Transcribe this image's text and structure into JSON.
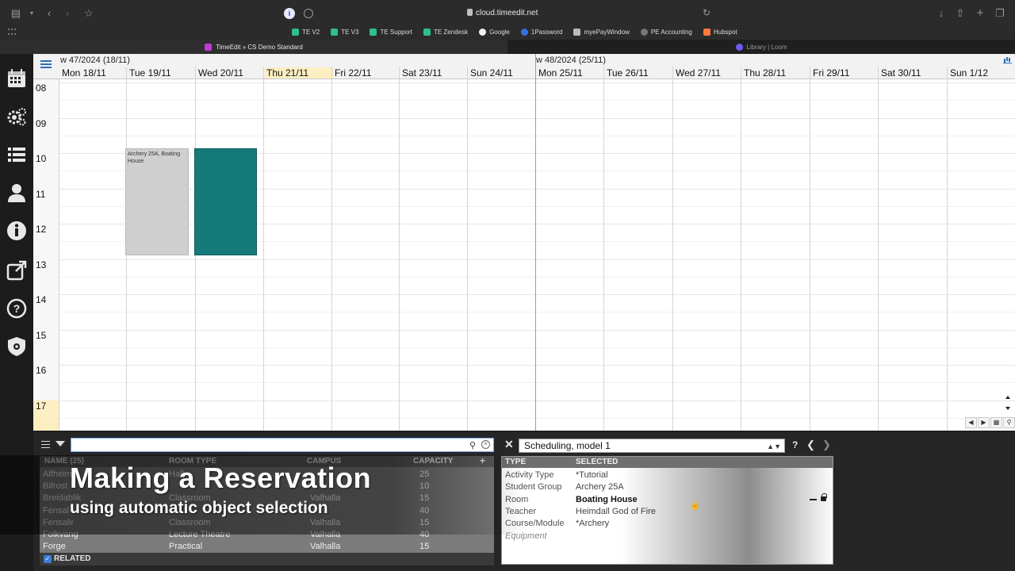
{
  "browser": {
    "url": "cloud.timeedit.net",
    "bookmarks": [
      "TE V2",
      "TE V3",
      "TE Support",
      "TE Zendesk",
      "Google",
      "1Password",
      "myePayWindow",
      "PE Accounting",
      "Hubspot"
    ],
    "tabs": [
      {
        "label": "TimeEdit » CS Demo Standard",
        "active": true
      },
      {
        "label": "Library | Loom",
        "active": false
      }
    ]
  },
  "calendar": {
    "weeks": [
      "w 47/2024 (18/11)",
      "w 48/2024 (25/11)"
    ],
    "days": [
      "Mon 18/11",
      "Tue 19/11",
      "Wed 20/11",
      "Thu 21/11",
      "Fri 22/11",
      "Sat 23/11",
      "Sun 24/11",
      "Mon 25/11",
      "Tue 26/11",
      "Wed 27/11",
      "Thu 28/11",
      "Fri 29/11",
      "Sat 30/11",
      "Sun 1/12"
    ],
    "today": "Thu 21/11",
    "hours": [
      "08",
      "09",
      "10",
      "11",
      "12",
      "13",
      "14",
      "15",
      "16",
      "17"
    ],
    "events": [
      {
        "label": "Archery 25A, Boating House",
        "color": "#cfcfcf"
      },
      {
        "label": "",
        "color": "#167a7a"
      }
    ]
  },
  "objects": {
    "search_value": "",
    "columns": [
      "NAME (25)",
      "ROOM TYPE",
      "CAMPUS",
      "CAPACITY"
    ],
    "rows": [
      [
        "Alfheim",
        "Hall",
        "",
        "25"
      ],
      [
        "Bifrost",
        "",
        "",
        "10"
      ],
      [
        "Breidablik",
        "Classroom",
        "Valhalla",
        "15"
      ],
      [
        "Fensal",
        "",
        "",
        "40"
      ],
      [
        "Fensalir",
        "Classroom",
        "Valhalla",
        "15"
      ],
      [
        "Folkvang",
        "Lecture Theatre",
        "Valhalla",
        "40"
      ],
      [
        "Forge",
        "Practical",
        "Valhalla",
        "15"
      ]
    ],
    "related_label": "RELATED",
    "related_checked": true
  },
  "reservation": {
    "model": "Scheduling, model 1",
    "columns": [
      "TYPE",
      "SELECTED"
    ],
    "rows": [
      {
        "type": "Activity Type",
        "value": "*Tutorial"
      },
      {
        "type": "Student Group",
        "value": "Archery 25A"
      },
      {
        "type": "Room",
        "value": "Boating House"
      },
      {
        "type": "Teacher",
        "value": "Heimdall God of Fire"
      },
      {
        "type": "Course/Module",
        "value": "*Archery"
      },
      {
        "type": "Equipment",
        "value": ""
      }
    ]
  },
  "caption": {
    "title": "Making a Reservation",
    "subtitle": "using automatic object selection"
  }
}
